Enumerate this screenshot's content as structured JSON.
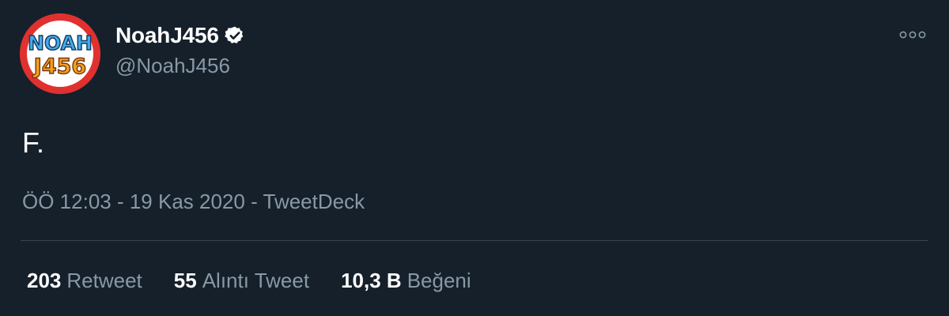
{
  "colors": {
    "background": "#15202b",
    "primary_text": "#ffffff",
    "secondary_text": "#8899a6",
    "divider": "#38444d",
    "verified": "#ffffff",
    "avatar_ring": "#e0312f"
  },
  "author": {
    "avatar_icon": "noah-j456-logo",
    "avatar_text_line1": "NOAH",
    "avatar_text_line2": "J456",
    "display_name": "NoahJ456",
    "verified_icon": "verified-badge-icon",
    "handle": "@NoahJ456"
  },
  "more_icon": "more-options-icon",
  "tweet": {
    "text": "F.",
    "time": "ÖÖ 12:03",
    "separator1": " - ",
    "date": "19 Kas 2020",
    "separator2": " - ",
    "source": "TweetDeck"
  },
  "stats": [
    {
      "count": "203",
      "label": "Retweet"
    },
    {
      "count": "55",
      "label": "Alıntı Tweet"
    },
    {
      "count": "10,3 B",
      "label": "Beğeni"
    }
  ]
}
